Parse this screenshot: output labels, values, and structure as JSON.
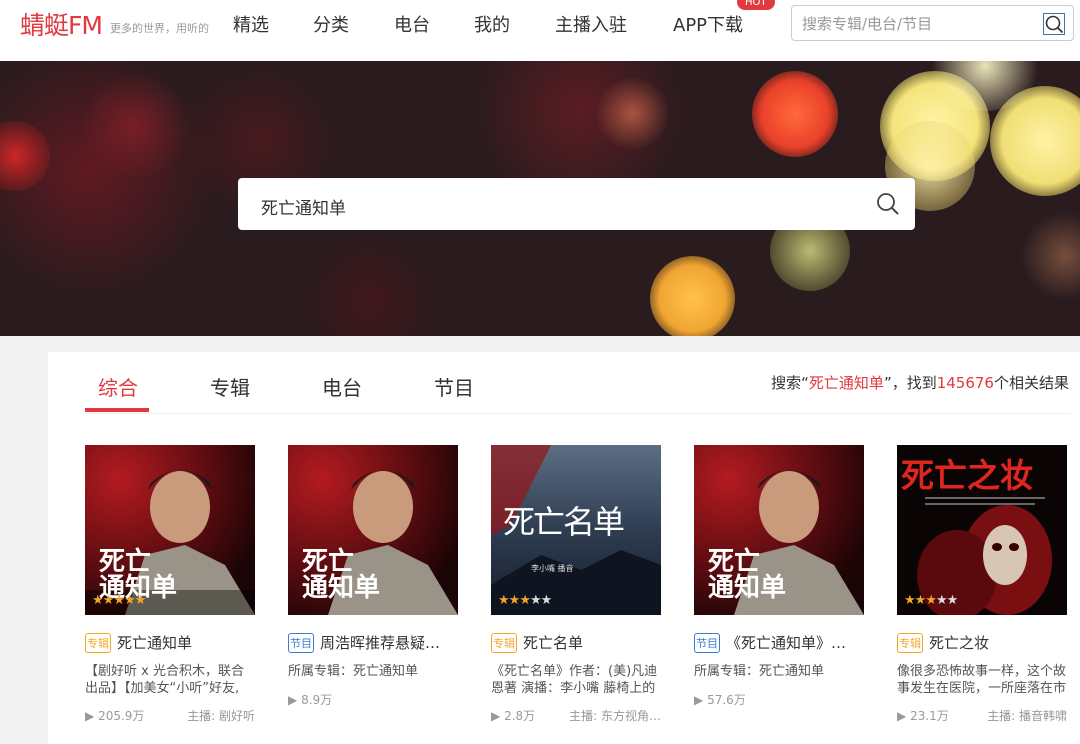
{
  "header": {
    "logo": "蜻蜓FM",
    "slogan": "更多的世界，用听的",
    "nav": [
      "精选",
      "分类",
      "电台",
      "我的",
      "主播入驻",
      "APP下载"
    ],
    "hot_badge": "HOT",
    "search_placeholder": "搜索专辑/电台/节目"
  },
  "banner": {
    "search_value": "死亡通知单"
  },
  "results": {
    "tabs": [
      "综合",
      "专辑",
      "电台",
      "节目"
    ],
    "active_tab": "综合",
    "summary_prefix": "搜索“",
    "summary_keyword": "死亡通知单",
    "summary_mid": "”，找到",
    "summary_count": "145676",
    "summary_suffix": "个相关结果",
    "cards": [
      {
        "badge": "专辑",
        "badge_type": "album",
        "title": "死亡通知单",
        "desc": "【剧好听 x 光合积木，联合出品】【加美女“小听”好友,",
        "plays": "205.9万",
        "author": "主播: 剧好听",
        "rating": 5,
        "cover_text_1": "死亡",
        "cover_text_2": "通知单"
      },
      {
        "badge": "节目",
        "badge_type": "program",
        "title": "周浩晖推荐悬疑…",
        "desc": "所属专辑：死亡通知单",
        "plays": "8.9万",
        "author": "",
        "rating": 0,
        "cover_text_1": "死亡",
        "cover_text_2": "通知单"
      },
      {
        "badge": "专辑",
        "badge_type": "album",
        "title": "死亡名单",
        "desc": "《死亡名单》作者：(美)凡迪恩著 演播：李小嘴 藤椅上的",
        "plays": "2.8万",
        "author": "主播: 东方视角…",
        "rating": 3,
        "cover_text_1": "死亡名单",
        "cover_text_2": "李小嘴 播音"
      },
      {
        "badge": "节目",
        "badge_type": "program",
        "title": "《死亡通知单》…",
        "desc": "所属专辑：死亡通知单",
        "plays": "57.6万",
        "author": "",
        "rating": 0,
        "cover_text_1": "死亡",
        "cover_text_2": "通知单"
      },
      {
        "badge": "专辑",
        "badge_type": "album",
        "title": "死亡之妆",
        "desc": "像很多恐怖故事一样，这个故事发生在医院，一所座落在市",
        "plays": "23.1万",
        "author": "主播: 播音韩啸",
        "rating": 3,
        "cover_text_1": "死亡之妆",
        "cover_text_2": ""
      }
    ]
  },
  "colors": {
    "brand": "#e2393e",
    "album_badge": "#f5a623",
    "program_badge": "#3a7bd5"
  }
}
